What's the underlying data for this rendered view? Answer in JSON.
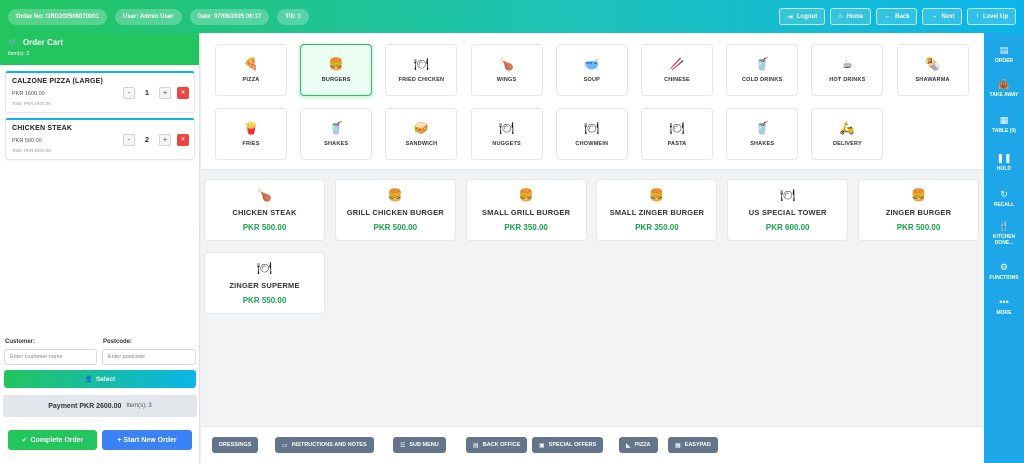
{
  "topbar": {
    "order_no": "Order No: ORD202508070001",
    "user": "User: Admin User",
    "date": "Date: 07/08/2025 06:17",
    "till": "Till: 1",
    "buttons": [
      {
        "label": "Logout",
        "icon": "logout-icon",
        "glyph": "⇥"
      },
      {
        "label": "Home",
        "icon": "home-icon",
        "glyph": "⌂"
      },
      {
        "label": "Back",
        "icon": "arrow-left-icon",
        "glyph": "←"
      },
      {
        "label": "Next",
        "icon": "arrow-right-icon",
        "glyph": "→"
      },
      {
        "label": "Level Up",
        "icon": "arrow-up-icon",
        "glyph": "↑"
      }
    ]
  },
  "cart": {
    "title": "Order Cart",
    "count": "Item(s): 3",
    "items": [
      {
        "name": "CALZONE PIZZA (LARGE)",
        "price": "PKR 1600.00",
        "qty": "1",
        "total": "Total: PKR 1600.00"
      },
      {
        "name": "CHICKEN STEAK",
        "price": "PKR 500.00",
        "qty": "2",
        "total": "Total: PKR 1000.00"
      }
    ],
    "minus": "-",
    "plus": "+",
    "remove": "×"
  },
  "customer": {
    "customer_label": "Customer:",
    "customer_placeholder": "Enter customer name",
    "postcode_label": "Postcode:",
    "postcode_placeholder": "Enter postcode",
    "select_label": "Select"
  },
  "payment": {
    "amount": "Payment PKR 2600.00",
    "items": "Item(s): 3"
  },
  "actions": {
    "complete": "Complete Order",
    "new_order": "+ Start New Order"
  },
  "categories": [
    {
      "name": "PIZZA",
      "glyph": "🍕",
      "icon": "pizza-icon"
    },
    {
      "name": "BURGERS",
      "glyph": "🍔",
      "icon": "burger-icon",
      "selected": true
    },
    {
      "name": "FRIED CHICKEN",
      "glyph": "🍽",
      "icon": "plate-icon"
    },
    {
      "name": "WINGS",
      "glyph": "🍗",
      "icon": "drumstick-icon"
    },
    {
      "name": "SOUP",
      "glyph": "🥣",
      "icon": "soup-icon"
    },
    {
      "name": "CHINESE",
      "glyph": "🥢",
      "icon": "chopsticks-icon"
    },
    {
      "name": "COLD DRINKS",
      "glyph": "🥤",
      "icon": "cup-icon"
    },
    {
      "name": "HOT DRINKS",
      "glyph": "☕",
      "icon": "hot-drink-icon"
    },
    {
      "name": "SHAWARMA",
      "glyph": "🌯",
      "icon": "wrap-icon"
    },
    {
      "name": "FRIES",
      "glyph": "🍟",
      "icon": "fries-icon"
    },
    {
      "name": "SHAKES",
      "glyph": "🥤",
      "icon": "cup-icon"
    },
    {
      "name": "SANDWICH",
      "glyph": "🥪",
      "icon": "sandwich-icon"
    },
    {
      "name": "NUGGETS",
      "glyph": "🍽",
      "icon": "plate-icon"
    },
    {
      "name": "CHOWMEIN",
      "glyph": "🍽",
      "icon": "plate-icon"
    },
    {
      "name": "PASTA",
      "glyph": "🍽",
      "icon": "plate-icon"
    },
    {
      "name": "SHAKES",
      "glyph": "🥤",
      "icon": "cup-icon"
    },
    {
      "name": "DELIVERY",
      "glyph": "🛵",
      "icon": "scooter-icon"
    }
  ],
  "products": [
    {
      "name": "CHICKEN STEAK",
      "price": "PKR 500.00",
      "glyph": "🍗",
      "icon": "drumstick-icon"
    },
    {
      "name": "GRILL CHICKEN BURGER",
      "price": "PKR 500.00",
      "glyph": "🍔",
      "icon": "burger-icon"
    },
    {
      "name": "SMALL GRILL BURGER",
      "price": "PKR 350.00",
      "glyph": "🍔",
      "icon": "burger-icon"
    },
    {
      "name": "SMALL ZINGER BURGER",
      "price": "PKR 350.00",
      "glyph": "🍔",
      "icon": "burger-icon"
    },
    {
      "name": "US SPECIAL TOWER",
      "price": "PKR 600.00",
      "glyph": "🍽",
      "icon": "plate-icon"
    },
    {
      "name": "ZINGER BURGER",
      "price": "PKR 500.00",
      "glyph": "🍔",
      "icon": "burger-icon"
    },
    {
      "name": "ZINGER SUPERME",
      "price": "PKR 550.00",
      "glyph": "🍽",
      "icon": "plate-icon"
    }
  ],
  "bottom_buttons": [
    {
      "label": "DRESSINGS",
      "glyph": "",
      "icon": ""
    },
    {
      "label": "INSTRUCTIONS AND NOTES",
      "glyph": "▭",
      "icon": "note-icon"
    },
    {
      "label": "SUB MENU",
      "glyph": "☰",
      "icon": "list-icon"
    },
    {
      "label": "BACK OFFICE",
      "glyph": "▤",
      "icon": "office-icon"
    },
    {
      "label": "SPECIAL OFFERS",
      "glyph": "▣",
      "icon": "gift-icon"
    },
    {
      "label": "PIZZA",
      "glyph": "◣",
      "icon": "pizza-icon"
    },
    {
      "label": "EASYPAD",
      "glyph": "▦",
      "icon": "keypad-icon"
    }
  ],
  "sidebar": [
    {
      "label": "ORDER",
      "glyph": "▤",
      "icon": "receipt-icon"
    },
    {
      "label": "TAKE AWAY",
      "glyph": "👜",
      "icon": "bag-icon"
    },
    {
      "label": "TABLE (0)",
      "glyph": "▦",
      "icon": "table-icon"
    },
    {
      "label": "HOLD",
      "glyph": "❚❚",
      "icon": "pause-icon"
    },
    {
      "label": "RECALL",
      "glyph": "↻",
      "icon": "recall-icon"
    },
    {
      "label": "KITCHEN DONE...",
      "glyph": "🍴",
      "icon": "utensils-icon"
    },
    {
      "label": "FUNCTIONS",
      "glyph": "⚙",
      "icon": "gear-icon"
    },
    {
      "label": "MORE",
      "glyph": "•••",
      "icon": "more-icon"
    }
  ]
}
